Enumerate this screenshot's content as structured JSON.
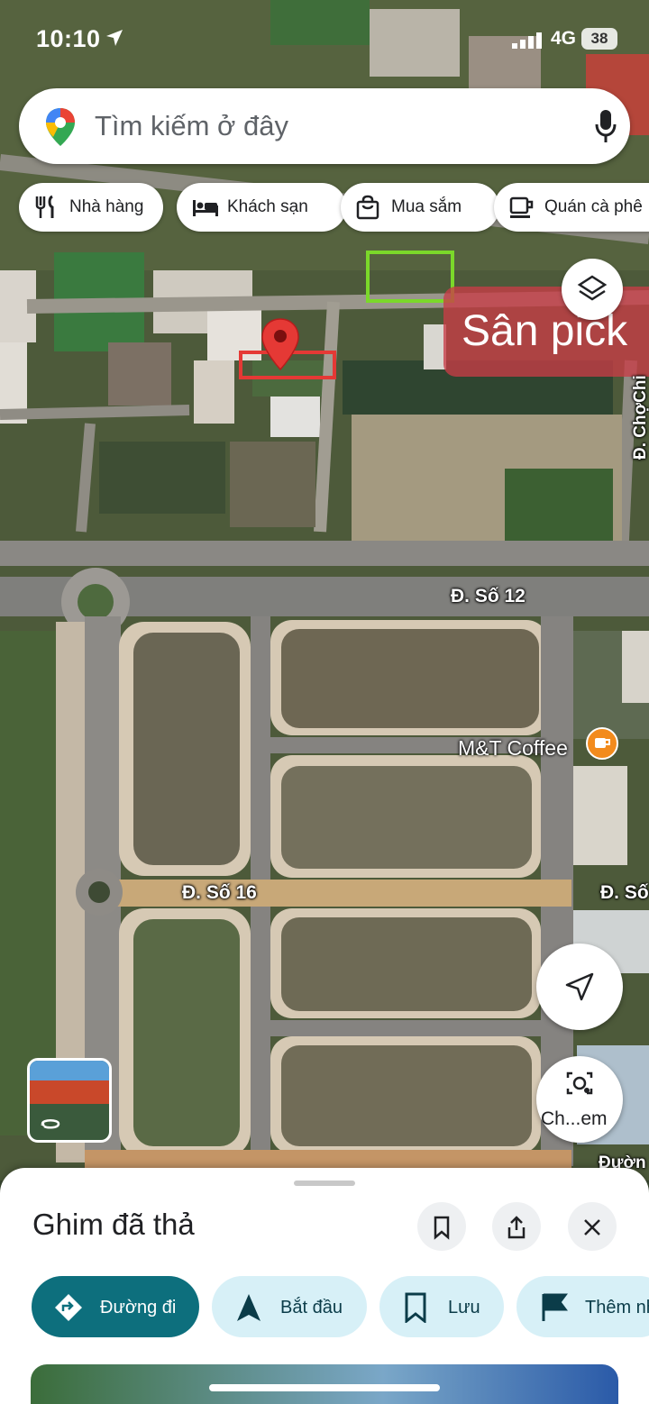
{
  "status_bar": {
    "time": "10:10",
    "network": "4G",
    "battery": "38"
  },
  "search": {
    "placeholder": "Tìm kiếm ở đây"
  },
  "chips": [
    {
      "label": "Nhà hàng",
      "icon": "restaurant-icon"
    },
    {
      "label": "Khách sạn",
      "icon": "hotel-icon"
    },
    {
      "label": "Mua sắm",
      "icon": "shopping-icon"
    },
    {
      "label": "Quán cà phê",
      "icon": "coffee-icon"
    }
  ],
  "map": {
    "overlay_label": "Sân pick",
    "streets": [
      "Đ. Số 12",
      "Đ. Số 16",
      "Đ. Số",
      "Đ. ChợChi",
      "Đườn"
    ],
    "poi": {
      "name": "M&T Coffee",
      "icon": "coffee-icon"
    },
    "lens_label": "Ch...em"
  },
  "sheet": {
    "title": "Ghim đã thả",
    "actions": [
      {
        "label": "Đường đi",
        "icon": "directions-icon"
      },
      {
        "label": "Bắt đầu",
        "icon": "navigation-arrow-icon"
      },
      {
        "label": "Lưu",
        "icon": "bookmark-icon"
      },
      {
        "label": "Thêm nh",
        "icon": "flag-icon"
      }
    ]
  },
  "colors": {
    "accent": "#0d6f7d",
    "chip_bg": "#d7f0f7",
    "pin": "#e53935",
    "highlight": "#7bd82a",
    "label_bg": "#c83c46"
  }
}
